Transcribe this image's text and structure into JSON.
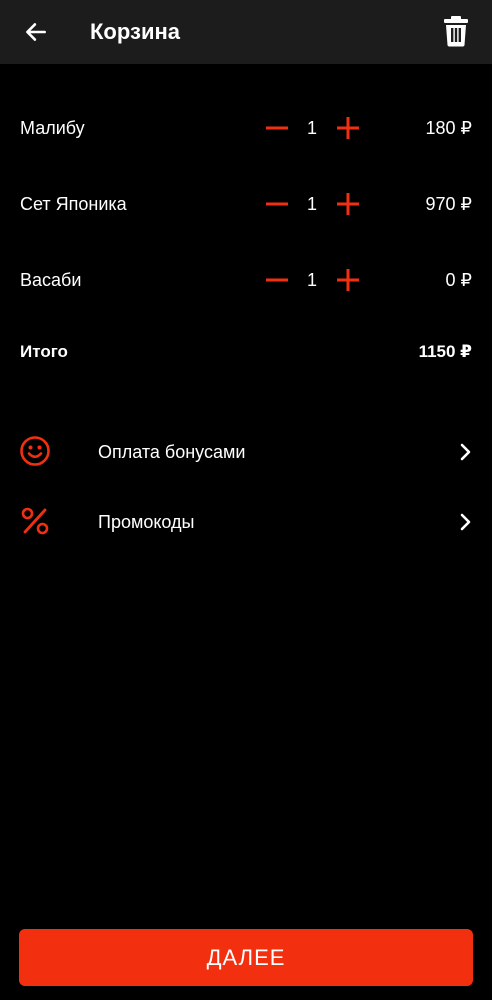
{
  "colors": {
    "accent": "#f23010",
    "background": "#000000",
    "header": "#1c1c1c",
    "text": "#ffffff"
  },
  "header": {
    "title": "Корзина",
    "back_icon": "arrow-left-icon",
    "trash_icon": "trash-icon"
  },
  "cart": {
    "items": [
      {
        "name": "Малибу",
        "qty": "1",
        "price": "180 ₽"
      },
      {
        "name": "Сет Японика",
        "qty": "1",
        "price": "970 ₽"
      },
      {
        "name": "Васаби",
        "qty": "1",
        "price": "0 ₽"
      }
    ],
    "total_label": "Итого",
    "total_value": "1150 ₽"
  },
  "options": [
    {
      "label": "Оплата бонусами",
      "icon": "smiley-icon"
    },
    {
      "label": "Промокоды",
      "icon": "percent-icon"
    }
  ],
  "next_button": {
    "label": "ДАЛЕЕ"
  }
}
